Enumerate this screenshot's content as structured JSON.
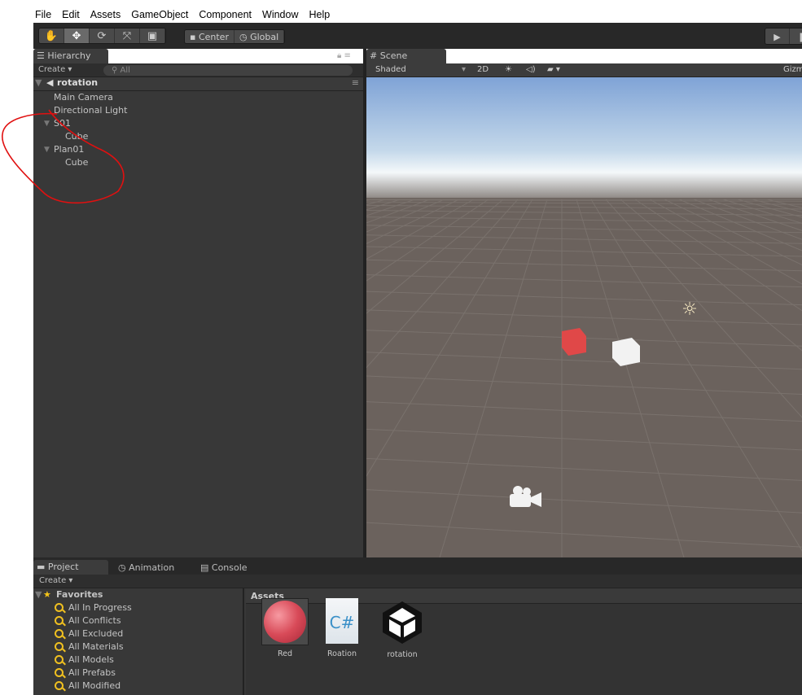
{
  "menu": [
    "File",
    "Edit",
    "Assets",
    "GameObject",
    "Component",
    "Window",
    "Help"
  ],
  "toolbar": {
    "tools": [
      "hand-icon",
      "move-icon",
      "rotate-icon",
      "scale-icon",
      "rect-icon"
    ],
    "pivot": "Center",
    "space": "Global"
  },
  "hierarchy": {
    "tab": "Hierarchy",
    "create": "Create",
    "search": "All",
    "scene": "rotation",
    "items": [
      {
        "label": "Main Camera",
        "depth": 0,
        "fold": false
      },
      {
        "label": "Directional Light",
        "depth": 0,
        "fold": false
      },
      {
        "label": "S01",
        "depth": 0,
        "fold": true
      },
      {
        "label": "Cube",
        "depth": 1,
        "fold": false
      },
      {
        "label": "Plan01",
        "depth": 0,
        "fold": true
      },
      {
        "label": "Cube",
        "depth": 1,
        "fold": false
      }
    ]
  },
  "scene": {
    "tab": "Scene",
    "shading": "Shaded",
    "mode2d": "2D",
    "gizmos": "Gizm"
  },
  "project": {
    "tabs": [
      "Project",
      "Animation",
      "Console"
    ],
    "create": "Create",
    "favorites": "Favorites",
    "fav_items": [
      "All In Progress",
      "All Conflicts",
      "All Excluded",
      "All Materials",
      "All Models",
      "All Prefabs",
      "All Modified"
    ],
    "assets_title": "Assets",
    "assets": [
      {
        "name": "Red",
        "type": "material"
      },
      {
        "name": "Roation",
        "type": "csharp-script"
      },
      {
        "name": "rotation",
        "type": "unity-scene"
      }
    ]
  },
  "colors": {
    "annotation": "#e01010",
    "cube_red": "#e04848",
    "panel": "#383838"
  }
}
